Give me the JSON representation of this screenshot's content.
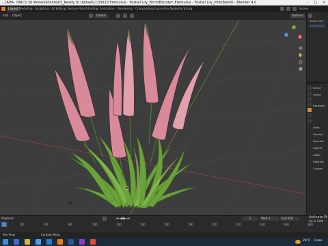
{
  "window": {
    "title": "...\\AHA- ONICS 3d Models\\Plants\\03_Ready to Upload\\LC03010 Eremurus - Foxtail Lily_Birch\\Blender\\ Eremurus - Foxtail Lily_Pink\\Blend\\ - Blender 4.0"
  },
  "workspace_tabs": [
    "Layout",
    "Modeling",
    "Sculpting",
    "UV Editing",
    "Texture Paint",
    "Shading",
    "Animation",
    "Rendering",
    "Compositing",
    "Geometry Nodes",
    "Scripting"
  ],
  "topbar_right": {
    "scene_label": "Scene"
  },
  "viewport_header": {
    "mode": "Edit",
    "object": "Object",
    "orientation": "Global",
    "options": "Options"
  },
  "viewport": {
    "gizmo": {
      "x": "X",
      "y": "Y",
      "z": "Z"
    }
  },
  "outliner": {
    "label": "Scene Coll"
  },
  "properties": {
    "tab_label": "Scene",
    "rows": [
      "Scene",
      "Backgrou",
      "Units",
      "Gravity",
      "Simulati",
      "Rigid B",
      "Audio",
      "Rigid Bo",
      "Custom"
    ]
  },
  "timeline": {
    "playback": "Playback",
    "keying": "Keying",
    "view": "View",
    "marker": "Marker",
    "current_frame": "1",
    "start_label": "Start",
    "start": "1",
    "end_label": "End",
    "end": "250",
    "ticks": [
      "40",
      "60",
      "80",
      "100",
      "120",
      "140",
      "160",
      "180",
      "200",
      "220",
      "240",
      "260",
      "280"
    ]
  },
  "statusbar": {
    "left": "Pan View",
    "middle": "Context Menu"
  },
  "activation": {
    "line1": "Activate W",
    "line2": "Go to Setti"
  },
  "taskbar": {
    "temperature": "26°C",
    "time": "Haze"
  },
  "colors": {
    "flower_pink": "#d98a9a",
    "grass_green": "#6aa13a",
    "viewport_bg": "#3d3d3d",
    "active_tab": "#3d3d3d"
  }
}
